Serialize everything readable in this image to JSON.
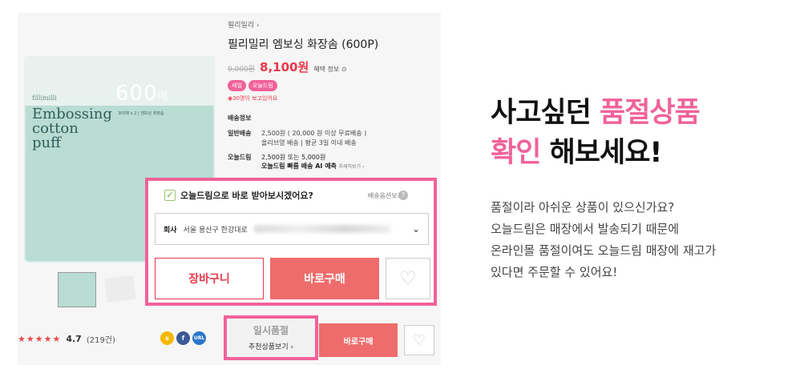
{
  "product_image": {
    "brand_small": "fillimilli",
    "box_text": "Embossing cotton puff",
    "count_num": "600",
    "count_unit": "매",
    "box_sub": "300매 x 2  |  엠보싱 화장솜"
  },
  "info": {
    "breadcrumb": "필리밀리 ›",
    "title": "필리밀리 엠보싱 화장솜 (600P)",
    "original_price": "9,000원",
    "sale_price": "8,100원",
    "benefit": "혜택 정보 ⊙",
    "badges": [
      "세일",
      "오늘드림"
    ],
    "viewers": "◉30명이 보고있어요",
    "shipping_title": "배송정보",
    "general_label": "일반배송",
    "general_value_1": "2,500원 ( 20,000 원 이상 무료배송 )",
    "general_value_2": "올리브영 배송 | 평균 3일 이내 배송",
    "today_label": "오늘드림",
    "today_value_1": "2,500원 또는 5,000원",
    "today_value_2": "오늘드림 빠름 배송 AI 예측",
    "today_more": "자세히보기 ›"
  },
  "popup": {
    "checkbox_label": "오늘드림으로 바로 받아보시겠어요?",
    "option_link": "배송옵션보기",
    "address_label": "회사",
    "address_value": "서울 용산구 한강대로",
    "cart_button": "장바구니",
    "buy_button": "바로구매"
  },
  "rating": {
    "stars": "★★★★★",
    "score": "4.7",
    "reviews": "(219건)"
  },
  "socials": [
    "s",
    "f",
    "URL"
  ],
  "bottom": {
    "oos_title": "일시품절",
    "oos_link": "추천상품보기 ›",
    "buy_button": "바로구매"
  },
  "headline": {
    "line1_black": "사고싶던 ",
    "line1_pink": "품절상품",
    "line2_pink": "확인",
    "line2_black": " 해보세요!"
  },
  "description": [
    "품절이라 아쉬운 상품이 있으신가요?",
    "오늘드림은 매장에서 발송되기 때문에",
    "온라인몰 품절이여도 오늘드림 매장에 재고가",
    "있다면 주문할 수 있어요!"
  ],
  "colors": {
    "accent_pink": "#f0629a",
    "sale_red": "#e7384a",
    "buy_button": "#ef6c6c"
  }
}
